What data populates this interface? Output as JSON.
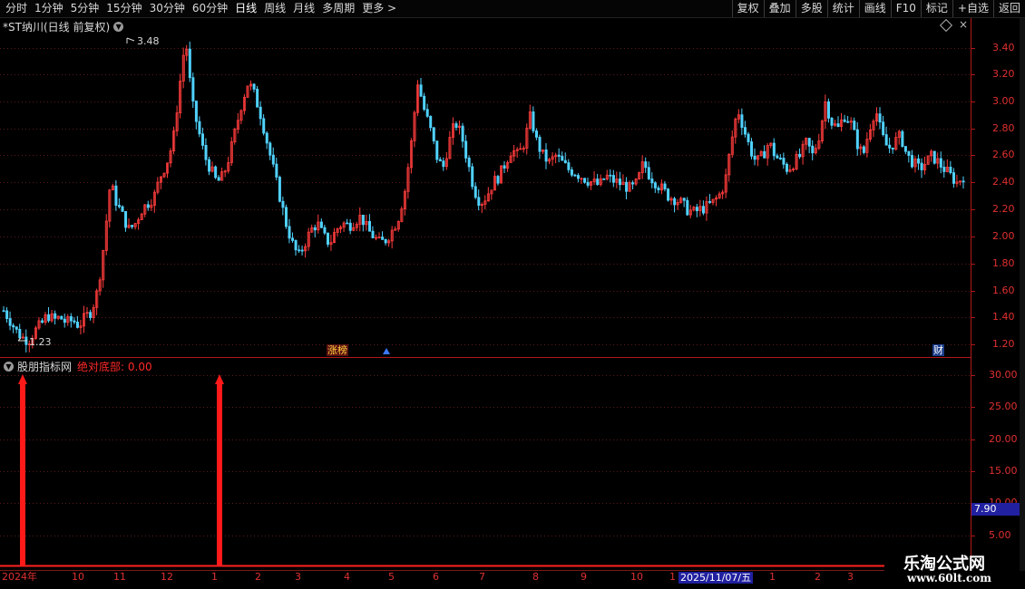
{
  "toolbar": {
    "periods": [
      "分时",
      "1分钟",
      "5分钟",
      "15分钟",
      "30分钟",
      "60分钟",
      "日线",
      "周线",
      "月线",
      "多周期",
      "更多 >"
    ],
    "active_period": "日线",
    "buttons": [
      "复权",
      "叠加",
      "多股",
      "统计",
      "画线",
      "F10",
      "标记",
      "+自选",
      "返回"
    ]
  },
  "chart": {
    "title": "*ST纳川(日线 前复权)",
    "high_label": "3.48",
    "low_label": "1.23",
    "price_axis": [
      "3.40",
      "3.20",
      "3.00",
      "2.80",
      "2.60",
      "2.40",
      "2.20",
      "2.00",
      "1.80",
      "1.60",
      "1.40",
      "1.20"
    ],
    "tags": {
      "zhangting": "涨榜",
      "cai": "财"
    },
    "colors": {
      "up": "#ff3c3c",
      "down": "#50d2ff",
      "grid": "#5a1a1a",
      "axis_text": "#e03030"
    }
  },
  "indicator": {
    "name": "股朋指标网",
    "label": "绝对底部: 0.00",
    "axis": [
      "30.00",
      "25.00",
      "20.00",
      "15.00",
      "10.00",
      "5.00"
    ],
    "current_value": "7.90"
  },
  "date_axis": {
    "labels": [
      "2024年",
      "10",
      "11",
      "12",
      "1",
      "2",
      "3",
      "4",
      "5",
      "6",
      "7",
      "8",
      "9",
      "10",
      "1",
      "1",
      "2",
      "3"
    ],
    "cursor_date": "2025/11/07/五"
  },
  "watermark": {
    "line1": "乐淘公式网",
    "line2": "www.60lt.com"
  },
  "chart_data": {
    "type": "candlestick",
    "title": "*ST纳川(日线 前复权)",
    "y_range": [
      1.2,
      3.48
    ],
    "close_path": [
      1.45,
      1.38,
      1.3,
      1.25,
      1.23,
      1.3,
      1.35,
      1.42,
      1.38,
      1.4,
      1.36,
      1.38,
      1.34,
      1.4,
      1.45,
      1.6,
      1.95,
      2.4,
      2.25,
      2.15,
      2.05,
      2.1,
      2.2,
      2.25,
      2.3,
      2.45,
      2.55,
      2.7,
      3.1,
      3.48,
      3.0,
      2.8,
      2.6,
      2.5,
      2.4,
      2.45,
      2.6,
      2.8,
      3.0,
      3.15,
      3.05,
      2.9,
      2.7,
      2.5,
      2.3,
      2.1,
      1.95,
      1.85,
      1.95,
      2.05,
      2.1,
      2.0,
      1.95,
      2.05,
      2.1,
      2.08,
      2.12,
      2.15,
      2.05,
      2.0,
      1.95,
      1.98,
      2.05,
      2.15,
      2.35,
      2.7,
      3.15,
      2.95,
      2.8,
      2.6,
      2.5,
      2.7,
      2.85,
      2.75,
      2.55,
      2.35,
      2.25,
      2.3,
      2.4,
      2.45,
      2.55,
      2.65,
      2.6,
      2.7,
      2.9,
      2.7,
      2.6,
      2.55,
      2.6,
      2.55,
      2.5,
      2.48,
      2.45,
      2.42,
      2.4,
      2.38,
      2.45,
      2.42,
      2.4,
      2.38,
      2.35,
      2.4,
      2.55,
      2.45,
      2.4,
      2.35,
      2.3,
      2.28,
      2.25,
      2.2,
      2.18,
      2.2,
      2.22,
      2.25,
      2.3,
      2.4,
      2.7,
      2.95,
      2.8,
      2.65,
      2.55,
      2.6,
      2.7,
      2.6,
      2.55,
      2.5,
      2.55,
      2.6,
      2.7,
      2.6,
      2.75,
      3.0,
      2.85,
      2.8,
      2.9,
      2.85,
      2.7,
      2.6,
      2.8,
      2.95,
      2.75,
      2.65,
      2.7,
      2.75,
      2.6,
      2.55,
      2.5,
      2.55,
      2.6,
      2.55,
      2.5,
      2.45,
      2.4,
      2.45
    ]
  }
}
